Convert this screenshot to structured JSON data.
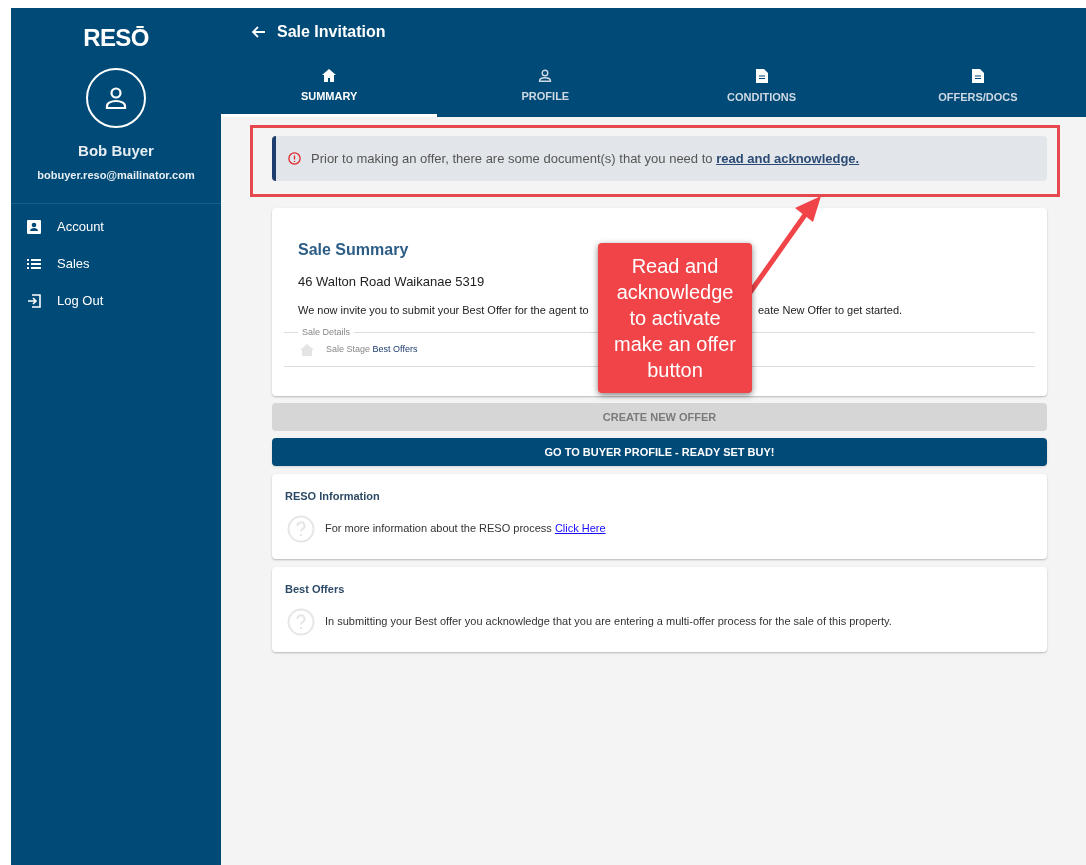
{
  "sidebar": {
    "logo": "RESŌ",
    "user_name": "Bob Buyer",
    "user_email": "bobuyer.reso@mailinator.com",
    "items": [
      {
        "kind": "account",
        "label": "Account"
      },
      {
        "kind": "sales",
        "label": "Sales"
      },
      {
        "kind": "logout",
        "label": "Log Out"
      }
    ]
  },
  "header": {
    "title": "Sale Invitation"
  },
  "tabs": [
    {
      "kind": "home",
      "label": "SUMMARY",
      "selected": true
    },
    {
      "kind": "person",
      "label": "PROFILE",
      "selected": false
    },
    {
      "kind": "doc",
      "label": "CONDITIONS",
      "selected": false
    },
    {
      "kind": "doc",
      "label": "OFFERS/DOCS",
      "selected": false
    }
  ],
  "alert": {
    "text": "Prior to making an offer, there are some document(s) that you need to",
    "link": "read and acknowledge."
  },
  "sale_summary": {
    "title": "Sale Summary",
    "address": "46 Walton Road Waikanae 5319",
    "intro_left": "We now invite you to submit your Best Offer for the agent to",
    "intro_right": "eate New Offer to get started.",
    "details_legend": "Sale Details",
    "stage_label": "Sale Stage",
    "stage_value": "Best Offers"
  },
  "buttons": [
    {
      "label": "CREATE NEW OFFER",
      "disabled": true
    },
    {
      "label": "GO TO BUYER PROFILE - READY SET BUY!",
      "disabled": false
    }
  ],
  "info_cards": [
    {
      "title": "RESO Information",
      "text": "For more information about the RESO process",
      "link": "Click Here"
    },
    {
      "title": "Best Offers",
      "text": "In submitting your Best offer you acknowledge that you are entering a multi-offer process for the sale of this property."
    }
  ],
  "annotation": {
    "callout": "Read and acknowledge to activate make an offer button"
  }
}
